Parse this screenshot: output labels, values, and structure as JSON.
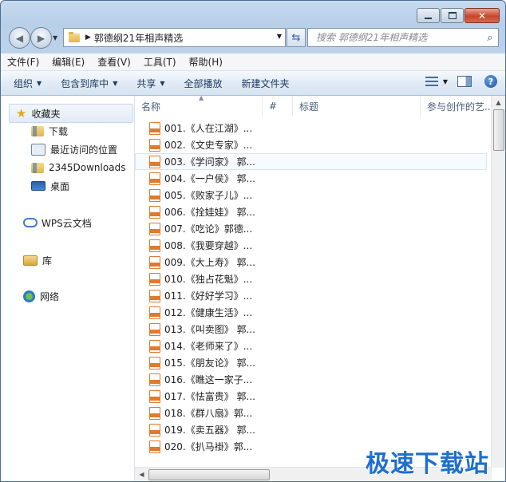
{
  "address": {
    "path": "郭德纲21年相声精选"
  },
  "search": {
    "placeholder": "搜索 郭德纲21年相声精选"
  },
  "menu": [
    "文件(F)",
    "编辑(E)",
    "查看(V)",
    "工具(T)",
    "帮助(H)"
  ],
  "commands": {
    "organize": "组织",
    "include_library": "包含到库中",
    "share": "共享",
    "play_all": "全部播放",
    "new_folder": "新建文件夹"
  },
  "nav": {
    "favorites": "收藏夹",
    "downloads": "下载",
    "recent": "最近访问的位置",
    "folder2345": "2345Downloads",
    "desktop": "桌面",
    "wps_cloud": "WPS云文档",
    "libraries": "库",
    "network": "网络"
  },
  "columns": {
    "name": "名称",
    "number": "#",
    "title": "标题",
    "artists": "参与创作的艺..."
  },
  "files": [
    "001.《人在江湖》...",
    "002.《文史专家》...",
    "003.《学问家》 郭...",
    "004.《一户侯》 郭...",
    "005.《败家子儿》...",
    "006.《拴娃娃》 郭...",
    "007.《吃论》郭德...",
    "008.《我要穿越》...",
    "009.《大上寿》 郭...",
    "010.《独占花魁》...",
    "011.《好好学习》...",
    "012.《健康生活》...",
    "013.《叫卖图》 郭...",
    "014.《老师来了》...",
    "015.《朋友论》 郭...",
    "016.《瞧这一家子...",
    "017.《怯富贵》 郭...",
    "018.《群八扇》郭...",
    "019.《卖五器》 郭...",
    "020.《扒马褂》郭..."
  ],
  "selected_index": 2,
  "watermark": "极速下载站"
}
